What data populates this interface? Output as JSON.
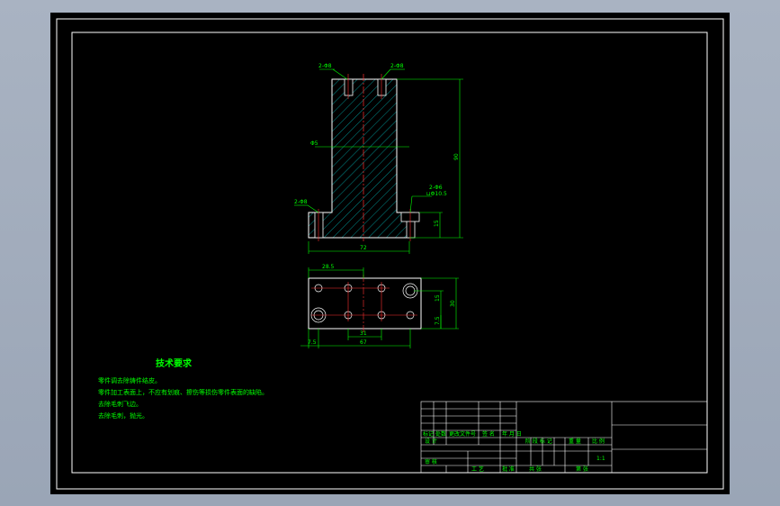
{
  "drawing": {
    "dimensions": {
      "top_left_hole": "2-Φ8",
      "top_right_hole": "2-Φ8",
      "center_dia": "Φ5",
      "left_hole": "2-Φ8",
      "right_callout_1": "2-Φ6",
      "right_callout_2": "⊔Φ10.5",
      "height": "90",
      "step_height": "15",
      "base_width": "72",
      "plan_offset": "28.5",
      "plan_depth": "30",
      "plan_pitch": "31",
      "plan_total": "67",
      "plan_left": "7.5",
      "plan_right_small": "7.5",
      "plan_right_mid": "15"
    }
  },
  "tech_requirements": {
    "title": "技术要求",
    "lines": [
      "零件调去除铸件结皮。",
      "零件加工表面上，不应有划痕、擦伤等损伤零件表面的缺陷。",
      "去除毛刺飞边。",
      "去除毛刺，抛光。"
    ]
  },
  "title_block": {
    "mark": "标记",
    "count": "处数",
    "zone": "更改文件号",
    "sign": "签 名",
    "date": "年 月 日",
    "design": "设 计",
    "stage_mark": "阶 段 标 记",
    "weight": "重 量",
    "scale_label": "比 例",
    "scale": "1:1",
    "review": "审 核",
    "process": "工 艺",
    "approve": "批 准",
    "sheets": "共  张",
    "sheet_no": "第  张"
  }
}
